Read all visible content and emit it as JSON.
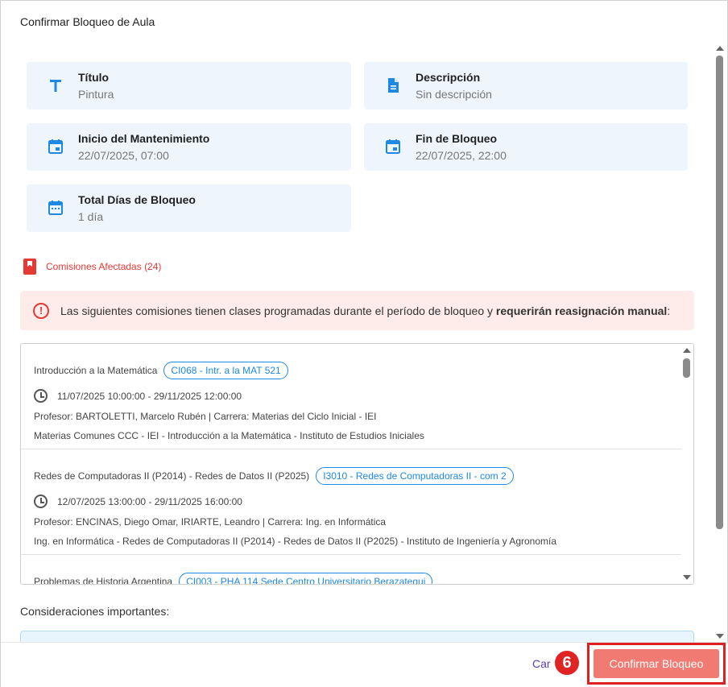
{
  "dialog": {
    "title": "Confirmar Bloqueo de Aula"
  },
  "cards": {
    "titulo": {
      "label": "Título",
      "value": "Pintura",
      "icon": "title-icon"
    },
    "descripcion": {
      "label": "Descripción",
      "value": "Sin descripción",
      "icon": "document-icon"
    },
    "inicio": {
      "label": "Inicio del Mantenimiento",
      "value": "22/07/2025, 07:00",
      "icon": "calendar-icon"
    },
    "fin": {
      "label": "Fin de Bloqueo",
      "value": "22/07/2025, 22:00",
      "icon": "calendar-icon"
    },
    "total": {
      "label": "Total Días de Bloqueo",
      "value": "1 día",
      "icon": "calendar-grid-icon"
    }
  },
  "affected": {
    "label": "Comisiones Afectadas (24)"
  },
  "alert": {
    "text_prefix": "Las siguientes comisiones tienen clases programadas durante el período de bloqueo y ",
    "text_bold": "requerirán reasignación manual",
    "text_suffix": ":"
  },
  "commissions": [
    {
      "subject": "Introducción a la Matemática",
      "code": "CI068 - Intr. a la MAT 521",
      "schedule": "11/07/2025 10:00:00 - 29/11/2025 12:00:00",
      "professor": "Profesor: BARTOLETTI, Marcelo Rubén | Carrera: Materias del Ciclo Inicial - IEI",
      "detail": "Materias Comunes CCC - IEI - Introducción a la Matemática - Instituto de Estudios Iniciales"
    },
    {
      "subject": "Redes de Computadoras II (P2014) - Redes de Datos II (P2025)",
      "code": "I3010 - Redes de Computadoras II - com 2",
      "schedule": "12/07/2025 13:00:00 - 29/11/2025 16:00:00",
      "professor": "Profesor: ENCINAS, Diego Omar, IRIARTE, Leandro | Carrera: Ing. en Informática",
      "detail": "Ing. en Informática - Redes de Computadoras II (P2014) - Redes de Datos II (P2025) - Instituto de Ingeniería y Agronomía"
    },
    {
      "subject": "Problemas de Historia Argentina",
      "code": "CI003 - PHA 114 Sede Centro Universitario Berazategui",
      "schedule": "",
      "professor": "",
      "detail": ""
    }
  ],
  "considerations": {
    "label": "Consideraciones importantes:"
  },
  "footer": {
    "cancel_label": "Cancelar",
    "cancel_visible": "Car",
    "step_badge": "6",
    "confirm_label": "Confirmar Bloqueo"
  },
  "colors": {
    "accent": "#1e88e5",
    "danger": "#e53935",
    "confirm": "#f17b72",
    "card_bg": "#eef5fd"
  }
}
